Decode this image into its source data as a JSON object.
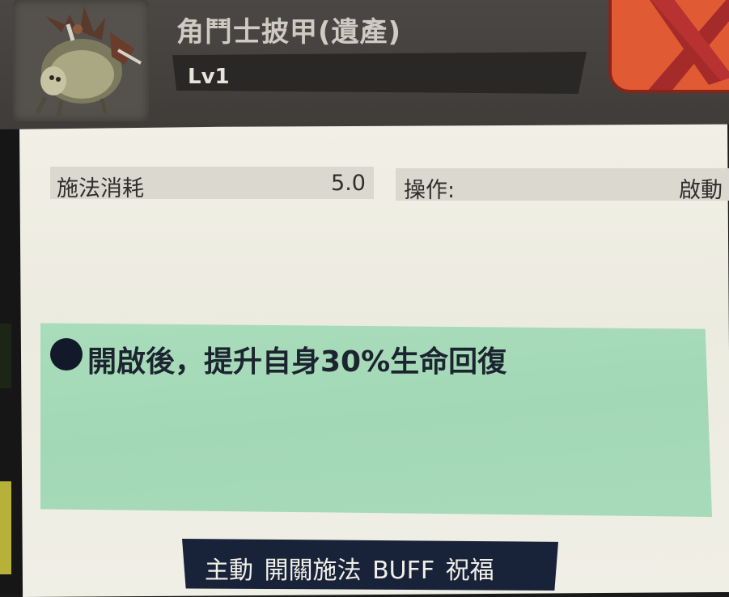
{
  "header": {
    "title": "角鬥士披甲(遺產)",
    "level": "Lv1",
    "portrait_icon": "armored-beast-icon",
    "close_icon": "close-x-icon"
  },
  "stats": {
    "cost_label": "施法消耗",
    "cost_value": "5.0",
    "operation_label": "操作:",
    "operation_value": "啟動"
  },
  "description": {
    "text": "開啟後，提升自身30%生命回復"
  },
  "tags": {
    "text": "主動 開關施法 BUFF 祝福"
  },
  "colors": {
    "header_bg": "#4a4744",
    "close_button": "#e05a33",
    "description_card": "#a9dcbb",
    "tags_bar": "#182238",
    "panel_bg": "#f2f0e6"
  }
}
